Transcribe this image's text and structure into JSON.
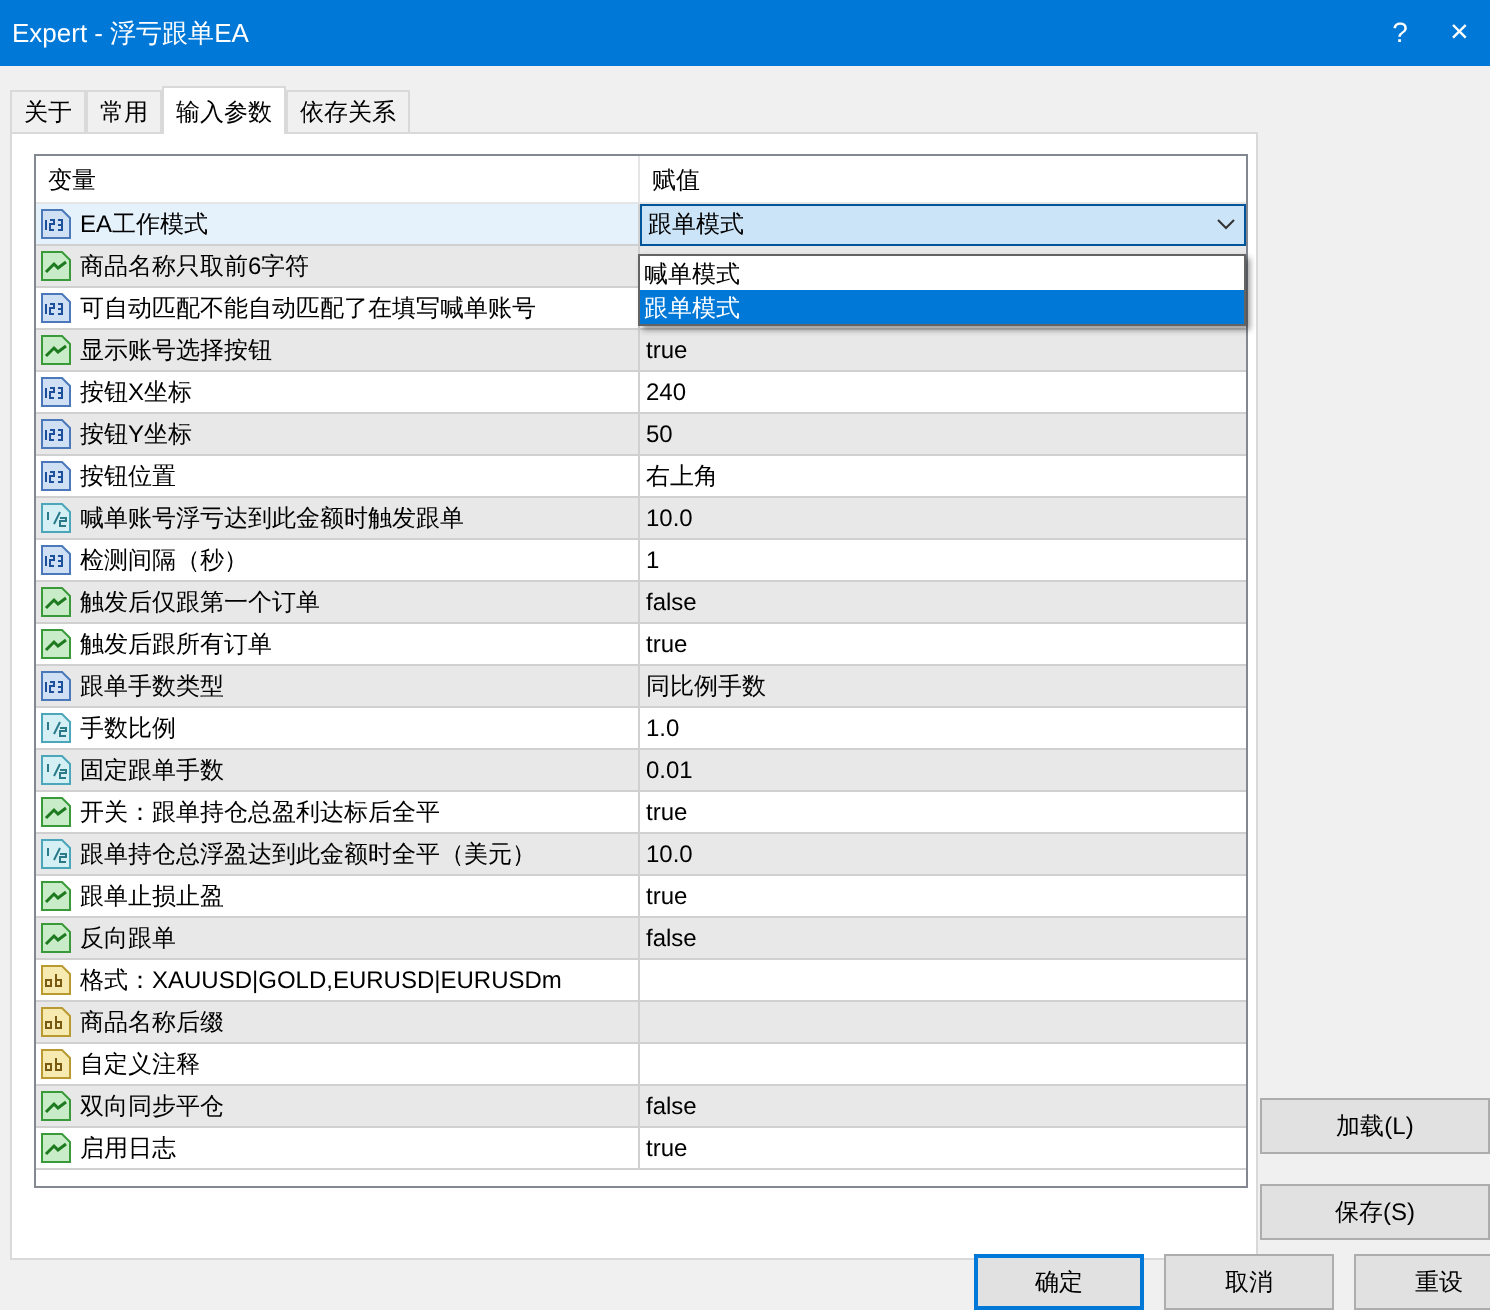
{
  "window": {
    "title": "Expert - 浮亏跟单EA",
    "help": "?",
    "close": "×"
  },
  "tabs": [
    {
      "label": "关于",
      "selected": false
    },
    {
      "label": "常用",
      "selected": false
    },
    {
      "label": "输入参数",
      "selected": true
    },
    {
      "label": "依存关系",
      "selected": false
    }
  ],
  "table": {
    "columns": [
      "变量",
      "赋值"
    ],
    "rows": [
      {
        "kind": "int",
        "name": "EA工作模式",
        "value": "跟单模式",
        "selected": true,
        "editing": true
      },
      {
        "kind": "bool",
        "name": "商品名称只取前6字符",
        "selected": false
      },
      {
        "kind": "int",
        "name": "可自动匹配不能自动匹配了在填写喊单账号",
        "selected": false
      },
      {
        "kind": "bool",
        "name": "显示账号选择按钮",
        "value": "true",
        "selected": false
      },
      {
        "kind": "int",
        "name": "按钮X坐标",
        "value": "240",
        "selected": false
      },
      {
        "kind": "int",
        "name": "按钮Y坐标",
        "value": "50",
        "selected": false
      },
      {
        "kind": "int",
        "name": "按钮位置",
        "value": "右上角",
        "selected": false
      },
      {
        "kind": "double",
        "name": "喊单账号浮亏达到此金额时触发跟单",
        "value": "10.0",
        "selected": false
      },
      {
        "kind": "int",
        "name": "检测间隔（秒）",
        "value": "1",
        "selected": false
      },
      {
        "kind": "bool",
        "name": "触发后仅跟第一个订单",
        "value": "false",
        "selected": false
      },
      {
        "kind": "bool",
        "name": "触发后跟所有订单",
        "value": "true",
        "selected": false
      },
      {
        "kind": "int",
        "name": "跟单手数类型",
        "value": "同比例手数",
        "selected": false
      },
      {
        "kind": "double",
        "name": "手数比例",
        "value": "1.0",
        "selected": false
      },
      {
        "kind": "double",
        "name": "固定跟单手数",
        "value": "0.01",
        "selected": false
      },
      {
        "kind": "bool",
        "name": "开关：跟单持仓总盈利达标后全平",
        "value": "true",
        "selected": false
      },
      {
        "kind": "double",
        "name": "跟单持仓总浮盈达到此金额时全平（美元）",
        "value": "10.0",
        "selected": false
      },
      {
        "kind": "bool",
        "name": "跟单止损止盈",
        "value": "true",
        "selected": false
      },
      {
        "kind": "bool",
        "name": "反向跟单",
        "value": "false",
        "selected": false
      },
      {
        "kind": "string",
        "name": "格式：XAUUSD|GOLD,EURUSD|EURUSDm",
        "selected": false
      },
      {
        "kind": "string",
        "name": "商品名称后缀",
        "selected": false
      },
      {
        "kind": "string",
        "name": "自定义注释",
        "selected": false
      },
      {
        "kind": "bool",
        "name": "双向同步平仓",
        "value": "false",
        "selected": false
      },
      {
        "kind": "bool",
        "name": "启用日志",
        "value": "true",
        "selected": false
      }
    ]
  },
  "dropdown_options": [
    {
      "label": "喊单模式",
      "selected": false
    },
    {
      "label": "跟单模式",
      "selected": true
    }
  ],
  "side_buttons": [
    "加载(L)",
    "保存(S)"
  ],
  "buttons": [
    {
      "label": "确定",
      "default": true
    },
    {
      "label": "取消",
      "default": false
    },
    {
      "label": "重设",
      "default": false
    }
  ]
}
